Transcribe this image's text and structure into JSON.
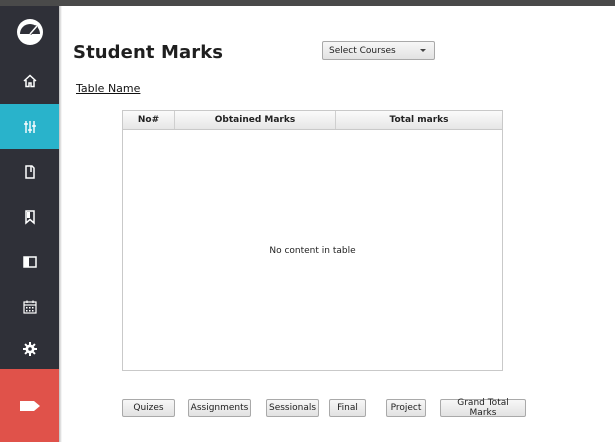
{
  "header": {
    "title": "Student Marks",
    "select_value": "Select Courses"
  },
  "table": {
    "name_link": "Table Name",
    "columns": [
      "No#",
      "Obtained Marks",
      "Total marks"
    ],
    "empty_message": "No content in table"
  },
  "sidebar": {
    "items": [
      {
        "icon": "gauge-logo-icon",
        "active": false
      },
      {
        "icon": "home-icon",
        "active": false
      },
      {
        "icon": "sliders-icon",
        "active": true
      },
      {
        "icon": "document-icon",
        "active": false
      },
      {
        "icon": "bookmark-icon",
        "active": false
      },
      {
        "icon": "panel-icon",
        "active": false
      },
      {
        "icon": "calendar-icon",
        "active": false
      },
      {
        "icon": "settings-icon",
        "active": false
      },
      {
        "icon": "exit-tag-icon",
        "active": false
      }
    ],
    "active_color": "#29b3cb",
    "exit_color": "#e0524a",
    "bg_color": "#2f3038"
  },
  "buttons": {
    "quizes": "Quizes",
    "assignments": "Assignments",
    "sessionals": "Sessionals",
    "final": "Final",
    "project": "Project",
    "grand_total": "Grand Total Marks"
  }
}
